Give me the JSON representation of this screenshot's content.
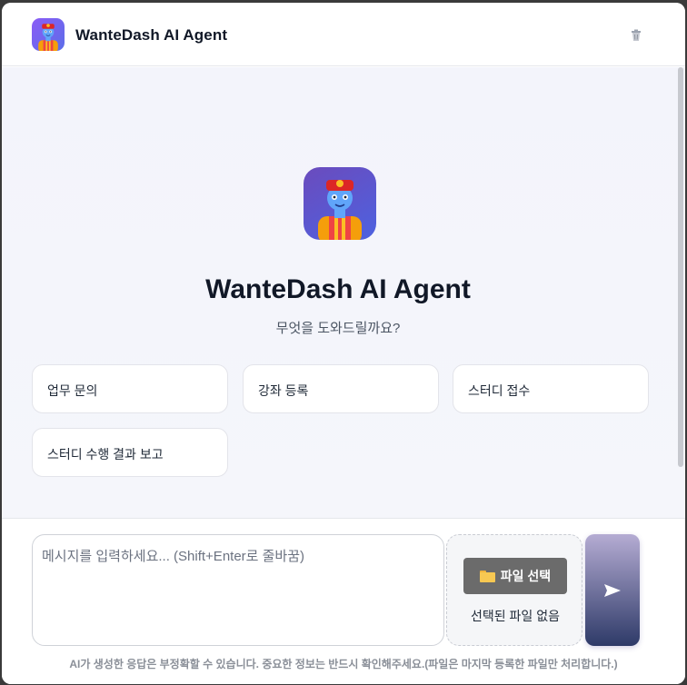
{
  "header": {
    "title": "WanteDash AI Agent",
    "logo_icon": "genie-avatar-icon",
    "clear_icon": "trash-icon"
  },
  "hero": {
    "title": "WanteDash AI Agent",
    "subtitle": "무엇을 도와드릴까요?",
    "logo_icon": "genie-avatar-icon"
  },
  "suggestions": [
    "업무 문의",
    "강좌 등록",
    "스터디 접수",
    "스터디 수행 결과 보고"
  ],
  "composer": {
    "placeholder": "메시지를 입력하세요... (Shift+Enter로 줄바꿈)",
    "value": "",
    "file_button_label": "파일 선택",
    "file_icon": "folder-icon",
    "file_status": "선택된 파일 없음",
    "send_icon": "send-arrow-icon"
  },
  "disclaimer": "AI가 생성한 응답은 부정확할 수 있습니다. 중요한 정보는 반드시 확인해주세요.(파일은 마지막 등록한 파일만 처리합니다.)",
  "colors": {
    "accent_gradient_start": "#8b5cf6",
    "accent_gradient_end": "#4d62e0",
    "send_gradient_start": "#b5acd3",
    "send_gradient_end": "#2e3a68",
    "file_button": "#6b6b6b"
  }
}
